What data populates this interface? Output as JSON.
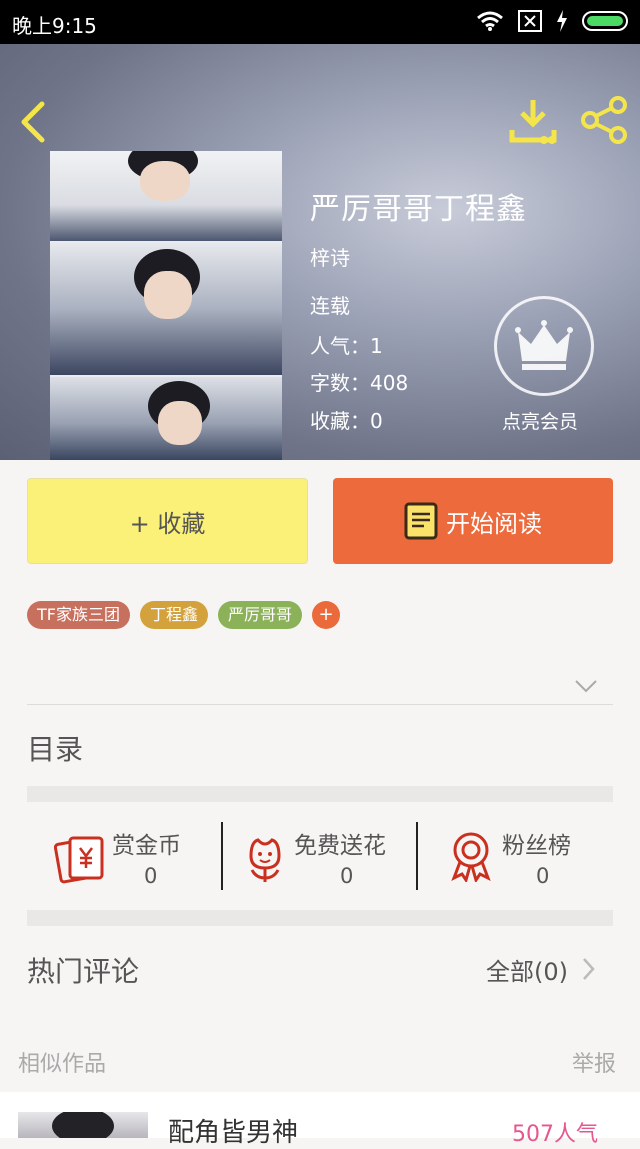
{
  "status_bar": {
    "time": "晚上9:15"
  },
  "book": {
    "title": "严厉哥哥丁程鑫",
    "author": "梓诗",
    "status": "连载",
    "popularity": "人气：1",
    "words": "字数：408",
    "favorites": "收藏：0",
    "vip_label": "点亮会员"
  },
  "actions": {
    "favorite": "+ 收藏",
    "read": "开始阅读"
  },
  "tags": [
    {
      "label": "TF家族三团",
      "color": "#c8705e"
    },
    {
      "label": "丁程鑫",
      "color": "#d4a23c"
    },
    {
      "label": "严厉哥哥",
      "color": "#8bb258"
    }
  ],
  "tag_add": "+",
  "catalog_title": "目录",
  "stats": {
    "reward": {
      "label": "赏金币",
      "value": "0"
    },
    "flowers": {
      "label": "免费送花",
      "value": "0"
    },
    "fans": {
      "label": "粉丝榜",
      "value": "0"
    }
  },
  "comments": {
    "title": "热门评论",
    "all": "全部(0)"
  },
  "similar": {
    "title": "相似作品",
    "report": "举报",
    "items": [
      {
        "title": "配角皆男神",
        "popularity": "507人气"
      }
    ]
  },
  "colors": {
    "accent": "#ec6a3b",
    "favorite_button": "#fbf178",
    "icon_red": "#c9301f",
    "pink": "#e6578f"
  },
  "icons": [
    "back-icon",
    "download-icon",
    "share-icon",
    "crown-icon",
    "book-icon",
    "red-envelope-icon",
    "flower-icon",
    "medal-icon",
    "chevron-down-icon",
    "chevron-right-icon",
    "wifi-icon",
    "sim-icon",
    "battery-icon"
  ]
}
